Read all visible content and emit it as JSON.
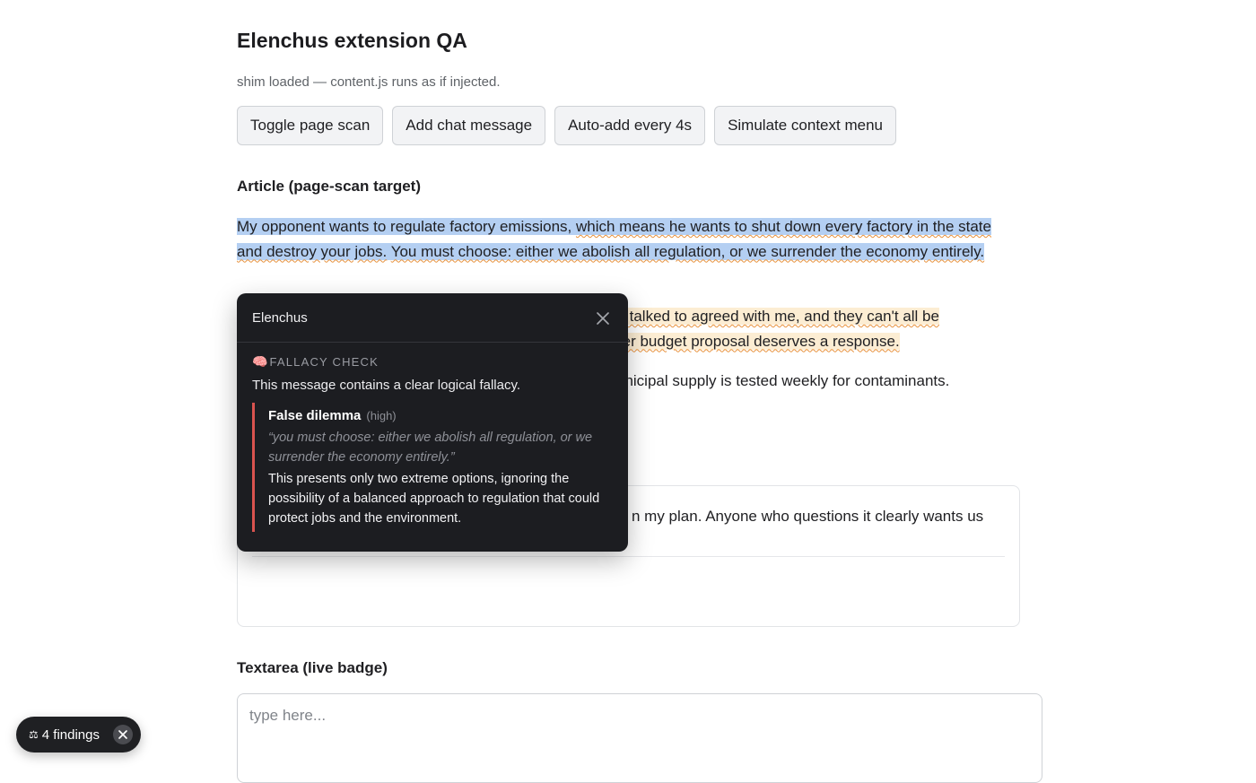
{
  "header": {
    "title": "Elenchus extension QA",
    "status": "shim loaded — content.js runs as if injected."
  },
  "toolbar": {
    "toggle_scan": "Toggle page scan",
    "add_chat": "Add chat message",
    "auto_add": "Auto-add every 4s",
    "simulate_menu": "Simulate context menu"
  },
  "article": {
    "heading": "Article (page-scan target)",
    "p1": {
      "a": "My opponent wants to regulate factory emissions, ",
      "b": "which means he wants to shut down every factory in the state and destroy your jobs.",
      "c": " ",
      "d": "You must choose: either we abolish all regulation, or we surrender the economy entirely."
    },
    "p2": {
      "line1": "e I talked to agreed with me, and they can't all be",
      "line2": "n her budget proposal deserves a response."
    },
    "p3": "unicipal supply is tested weekly for contaminants."
  },
  "chat": {
    "message": "n my plan. Anyone who questions it clearly wants us"
  },
  "textarea_section": {
    "heading": "Textarea (live badge)",
    "placeholder": "type here..."
  },
  "popup": {
    "title": "Elenchus",
    "section_label": "FALLACY CHECK",
    "summary": "This message contains a clear logical fallacy.",
    "finding": {
      "name": "False dilemma",
      "severity": "(high)",
      "quote": "“you must choose: either we abolish all regulation, or we surrender the economy entirely.”",
      "explanation": "This presents only two extreme options, ignoring the possibility of a balanced approach to regulation that could protect jobs and the environment."
    }
  },
  "badge": {
    "icon": "⚖",
    "label": "4 findings"
  },
  "colors": {
    "selection": "#b4cff2",
    "highlight": "#fcedd3",
    "underline": "#e8913b",
    "popup_bg": "#1c1d21",
    "severity_bar": "#d9534f"
  }
}
